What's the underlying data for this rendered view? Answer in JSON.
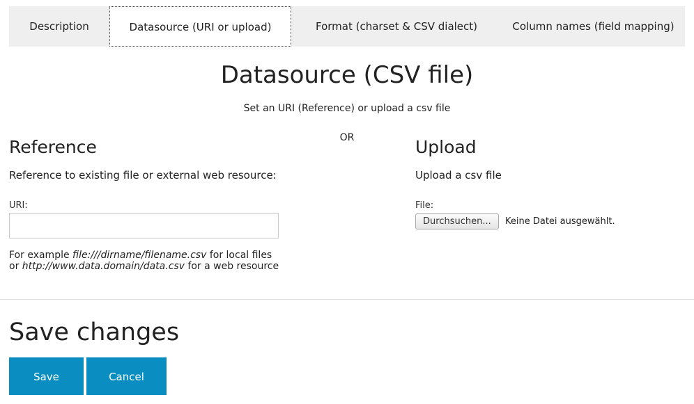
{
  "tabs": [
    {
      "label": "Description",
      "active": false
    },
    {
      "label": "Datasource (URI or upload)",
      "active": true
    },
    {
      "label": "Format (charset & CSV dialect)",
      "active": false
    },
    {
      "label": "Column names (field mapping)",
      "active": false
    }
  ],
  "page": {
    "title": "Datasource (CSV file)",
    "subtitle": "Set an URI (Reference) or upload a csv file",
    "or_label": "OR"
  },
  "reference": {
    "heading": "Reference",
    "description": "Reference to existing file or external web resource:",
    "uri_label": "URI:",
    "uri_value": "",
    "uri_placeholder": "",
    "example_prefix": "For example ",
    "example_local": "file:///dirname/filename.csv",
    "example_local_suffix": " for local files",
    "example_or": "or ",
    "example_web": "http://www.data.domain/data.csv",
    "example_web_suffix": " for a web resource"
  },
  "upload": {
    "heading": "Upload",
    "description": "Upload a csv file",
    "file_label": "File:",
    "browse_label": "Durchsuchen...",
    "file_status": "Keine Datei ausgewählt."
  },
  "actions": {
    "heading": "Save changes",
    "save_label": "Save",
    "cancel_label": "Cancel"
  },
  "colors": {
    "accent": "#0a8dc0",
    "tab_bar": "#efefef"
  }
}
